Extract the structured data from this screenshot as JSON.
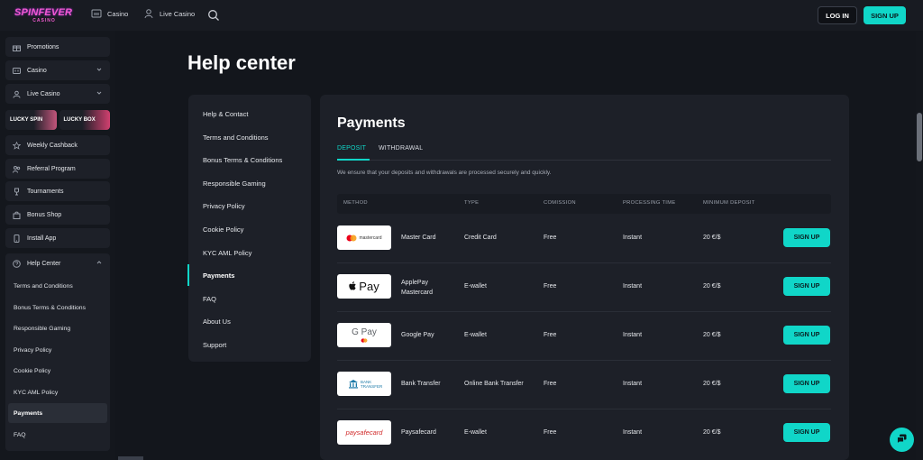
{
  "header": {
    "logo_text": "SPINFEVER",
    "logo_sub": "CASINO",
    "nav": [
      {
        "label": "Casino",
        "icon": "casino-icon"
      },
      {
        "label": "Live Casino",
        "icon": "live-casino-icon"
      }
    ],
    "login_label": "LOG IN",
    "signup_label": "SIGN UP",
    "accent": "#10d6c8",
    "brand": "#f25ad0"
  },
  "sidebar": {
    "items": [
      {
        "label": "Promotions",
        "icon": "gift-icon"
      },
      {
        "label": "Casino",
        "icon": "slot-icon"
      },
      {
        "label": "Live Casino",
        "icon": "dealer-icon"
      },
      {
        "label": "Weekly Cashback",
        "icon": "star-icon"
      },
      {
        "label": "Referral Program",
        "icon": "users-icon"
      },
      {
        "label": "Tournaments",
        "icon": "trophy-icon"
      },
      {
        "label": "Bonus Shop",
        "icon": "shop-icon"
      },
      {
        "label": "Install App",
        "icon": "phone-icon"
      },
      {
        "label": "Help Center",
        "icon": "help-icon"
      }
    ],
    "lucky_spin": "LUCKY SPIN",
    "lucky_box": "LUCKY BOX",
    "help_sub": [
      "Terms and Conditions",
      "Bonus Terms & Conditions",
      "Responsible Gaming",
      "Privacy Policy",
      "Cookie Policy",
      "KYC AML Policy",
      "Payments",
      "FAQ"
    ]
  },
  "main": {
    "title": "Help center",
    "nav": [
      "Help & Contact",
      "Terms and Conditions",
      "Bonus Terms & Conditions",
      "Responsible Gaming",
      "Privacy Policy",
      "Cookie Policy",
      "KYC AML Policy",
      "Payments",
      "FAQ",
      "About Us",
      "Support"
    ],
    "active_nav": "Payments",
    "panel": {
      "title": "Payments",
      "tabs": [
        "DEPOSIT",
        "WITHDRAWAL"
      ],
      "active_tab": "DEPOSIT",
      "description": "We ensure that your deposits and withdrawals are processed securely and quickly.",
      "columns": [
        "METHOD",
        "TYPE",
        "COMISSION",
        "PROCESSING TIME",
        "MINIMUM DEPOSIT"
      ],
      "rows": [
        {
          "logo": "mastercard",
          "name": "Master Card",
          "type": "Credit Card",
          "commission": "Free",
          "time": "Instant",
          "min": "20 €/$",
          "button": "SIGN UP"
        },
        {
          "logo": "Pay",
          "name": "ApplePay Mastercard",
          "type": "E-wallet",
          "commission": "Free",
          "time": "Instant",
          "min": "20 €/$",
          "button": "SIGN UP"
        },
        {
          "logo": "G Pay",
          "name": "Google Pay",
          "type": "E-wallet",
          "commission": "Free",
          "time": "Instant",
          "min": "20 €/$",
          "button": "SIGN UP"
        },
        {
          "logo": "BANK TRANSFER",
          "name": "Bank Transfer",
          "type": "Online Bank Transfer",
          "commission": "Free",
          "time": "Instant",
          "min": "20 €/$",
          "button": "SIGN UP"
        },
        {
          "logo": "paysafecard",
          "name": "Paysafecard",
          "type": "E-wallet",
          "commission": "Free",
          "time": "Instant",
          "min": "20 €/$",
          "button": "SIGN UP"
        }
      ]
    }
  }
}
